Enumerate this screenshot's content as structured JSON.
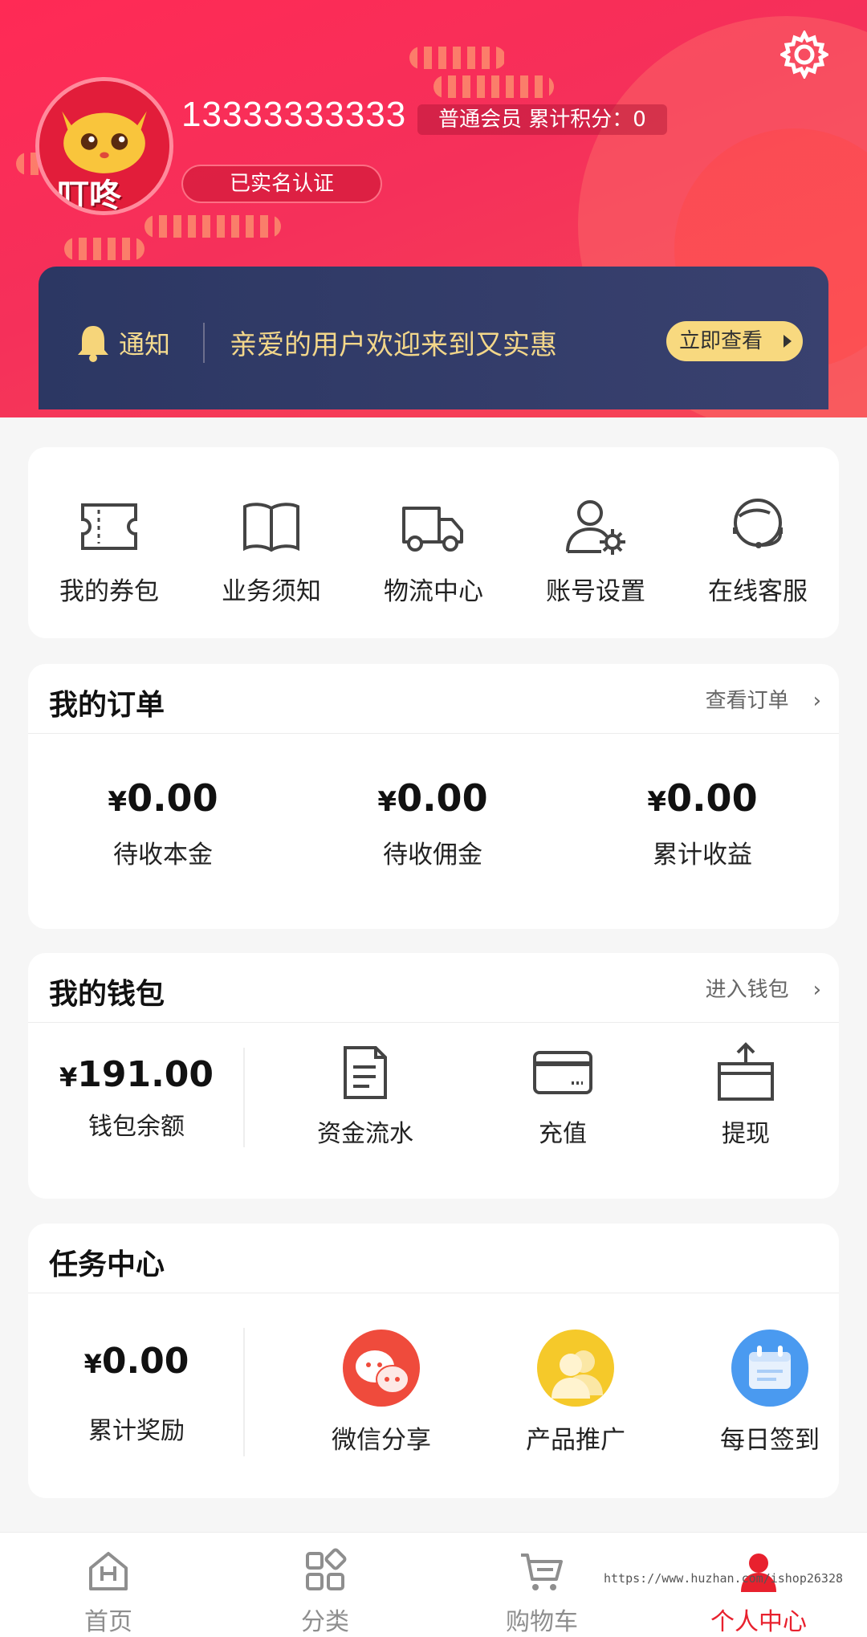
{
  "header": {
    "phone": "13333333333",
    "member_info": "普通会员 累计积分：0",
    "verified_label": "已实名认证",
    "avatar_text": "叮咚"
  },
  "notice": {
    "label": "通知",
    "message": "亲爱的用户欢迎来到又实惠",
    "button": "立即查看"
  },
  "quick_menu": [
    {
      "label": "我的券包",
      "icon": "coupon-icon"
    },
    {
      "label": "业务须知",
      "icon": "book-icon"
    },
    {
      "label": "物流中心",
      "icon": "truck-icon"
    },
    {
      "label": "账号设置",
      "icon": "user-gear-icon"
    },
    {
      "label": "在线客服",
      "icon": "headset-icon"
    }
  ],
  "orders": {
    "title": "我的订单",
    "more": "查看订单",
    "chevron": "›",
    "currency": "¥",
    "stats": [
      {
        "value": "0.00",
        "label": "待收本金"
      },
      {
        "value": "0.00",
        "label": "待收佣金"
      },
      {
        "value": "0.00",
        "label": "累计收益"
      }
    ]
  },
  "wallet": {
    "title": "我的钱包",
    "more": "进入钱包",
    "chevron": "›",
    "currency": "¥",
    "balance": "191.00",
    "balance_label": "钱包余额",
    "actions": [
      {
        "label": "资金流水",
        "icon": "ledger-icon"
      },
      {
        "label": "充值",
        "icon": "card-icon"
      },
      {
        "label": "提现",
        "icon": "withdraw-icon"
      }
    ]
  },
  "tasks": {
    "title": "任务中心",
    "currency": "¥",
    "reward": "0.00",
    "reward_label": "累计奖励",
    "actions": [
      {
        "label": "微信分享",
        "icon": "wechat-icon",
        "color": "#ef4b3c"
      },
      {
        "label": "产品推广",
        "icon": "users-icon",
        "color": "#f5c92a"
      },
      {
        "label": "每日签到",
        "icon": "calendar-icon",
        "color": "#4a9af0"
      }
    ]
  },
  "tabbar": [
    {
      "label": "首页",
      "icon": "home-icon"
    },
    {
      "label": "分类",
      "icon": "category-icon"
    },
    {
      "label": "购物车",
      "icon": "cart-icon"
    },
    {
      "label": "个人中心",
      "icon": "person-icon",
      "active": true
    }
  ],
  "watermark": "https://www.huzhan.com/ishop26328",
  "colors": {
    "brand_red": "#f5305a",
    "accent_gold": "#f8d97f",
    "notice_bg": "#2c3763",
    "active_tab": "#e8212e"
  }
}
